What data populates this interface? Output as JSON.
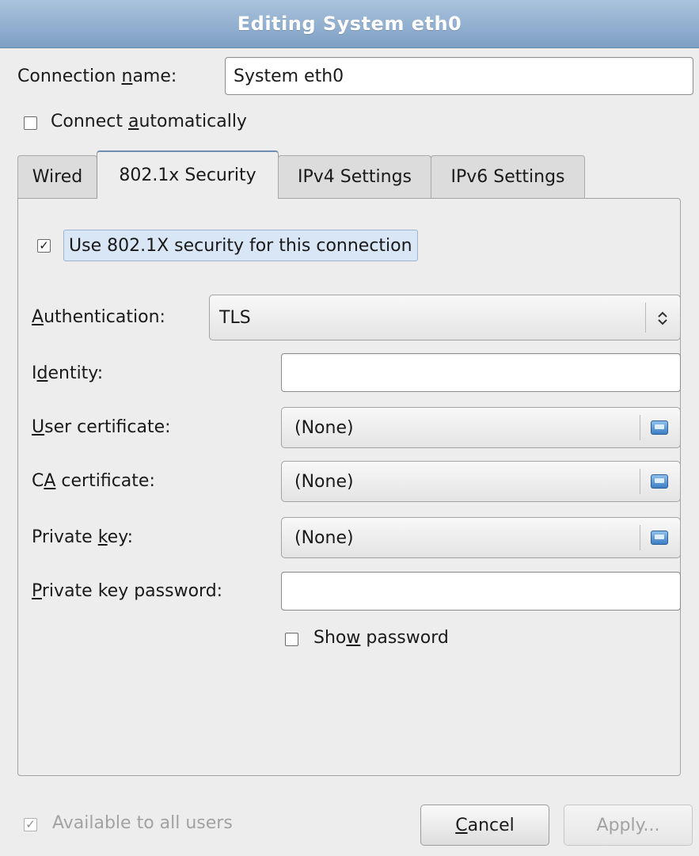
{
  "window": {
    "title": "Editing System eth0"
  },
  "connection": {
    "name_label_pre": "Connection ",
    "name_label_u": "n",
    "name_label_post": "ame:",
    "name_value": "System eth0",
    "auto_pre": "Connect ",
    "auto_u": "a",
    "auto_post": "utomatically",
    "auto_checked": false
  },
  "tabs": [
    {
      "label": "Wired"
    },
    {
      "label": "802.1x Security"
    },
    {
      "label": "IPv4 Settings"
    },
    {
      "label": "IPv6 Settings"
    }
  ],
  "active_tab": "802.1x Security",
  "security": {
    "use_label": "Use 802.1X security for this connection",
    "use_checked": true,
    "auth_label_u": "A",
    "auth_label_post": "uthentication:",
    "auth_value": "TLS",
    "identity_pre": "I",
    "identity_u": "d",
    "identity_post": "entity:",
    "identity_value": "",
    "user_cert_u": "U",
    "user_cert_post": "ser certificate:",
    "user_cert_value": "(None)",
    "ca_cert_pre": "C",
    "ca_cert_u": "A",
    "ca_cert_post": " certificate:",
    "ca_cert_value": "(None)",
    "pkey_pre": "Private ",
    "pkey_u": "k",
    "pkey_post": "ey:",
    "pkey_value": "(None)",
    "pkey_pw_u": "P",
    "pkey_pw_post": "rivate key password:",
    "pkey_pw_value": "",
    "show_pw_pre": "Sho",
    "show_pw_u": "w",
    "show_pw_post": " password",
    "show_pw_checked": false
  },
  "footer": {
    "available_label": "Available to all users",
    "available_checked": true,
    "cancel_u": "C",
    "cancel_post": "ancel",
    "apply_label": "Apply..."
  },
  "colors": {
    "titlebar": "#7e9fc4",
    "highlight": "#d9e6f5",
    "folder": "#3c7fc4"
  },
  "icons": {
    "combo_arrow": "up-down-chevron-icon",
    "file_chooser": "folder-icon"
  }
}
